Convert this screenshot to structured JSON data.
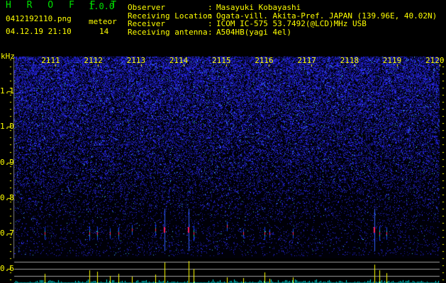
{
  "header": {
    "app_title": "H R O F F T",
    "version": "1.0.0",
    "filename": "0412192110.png",
    "datetime": "04.12.19 21:10",
    "meteor_label": "meteor",
    "meteor_count": "14",
    "info": [
      {
        "label": "Observer",
        "value": "Masayuki Kobayashi"
      },
      {
        "label": "Receiving Location",
        "value": "Ogata-vill. Akita-Pref. JAPAN (139.96E, 40.02N)"
      },
      {
        "label": "Receiver",
        "value": "ICOM IC-575 53.7492(@LCD)MHz USB"
      },
      {
        "label": "Receiving antenna",
        "value": "A504HB(yagi 4el)"
      }
    ]
  },
  "chart_data": {
    "type": "heatmap",
    "ylabel": "kHz",
    "x_ticks": [
      "2111",
      "2112",
      "2113",
      "2114",
      "2115",
      "2116",
      "2117",
      "2118",
      "2119",
      "2120"
    ],
    "y_ticks": [
      "1.1",
      "1.0",
      "0.9",
      "0.8",
      "0.7",
      "0.6"
    ],
    "ylim": [
      0.56,
      1.2
    ],
    "xlim_minutes_after_2110": [
      0,
      10
    ],
    "colors": {
      "noise": "#2020ff",
      "meteor_peak": "#ff2060",
      "bars": "#ffff00",
      "baseline": "#00e8e8",
      "text": "#ffff00"
    },
    "meteors": [
      {
        "t": 0.75,
        "f": 0.7,
        "strength": 13
      },
      {
        "t": 1.8,
        "f": 0.7,
        "strength": 18
      },
      {
        "t": 1.97,
        "f": 0.7,
        "strength": 16
      },
      {
        "t": 2.28,
        "f": 0.7,
        "strength": 10
      },
      {
        "t": 2.47,
        "f": 0.7,
        "strength": 13
      },
      {
        "t": 2.79,
        "f": 0.71,
        "strength": 9
      },
      {
        "t": 3.34,
        "f": 0.71,
        "strength": 12
      },
      {
        "t": 3.55,
        "f": 0.71,
        "strength": 29
      },
      {
        "t": 4.12,
        "f": 0.71,
        "strength": 31
      },
      {
        "t": 4.23,
        "f": 0.7,
        "strength": 20
      },
      {
        "t": 5.02,
        "f": 0.72,
        "strength": 8
      },
      {
        "t": 5.4,
        "f": 0.7,
        "strength": 7
      },
      {
        "t": 5.9,
        "f": 0.7,
        "strength": 15
      },
      {
        "t": 6.02,
        "f": 0.7,
        "strength": 6
      },
      {
        "t": 6.56,
        "f": 0.7,
        "strength": 8
      },
      {
        "t": 8.47,
        "f": 0.71,
        "strength": 26
      },
      {
        "t": 8.58,
        "f": 0.7,
        "strength": 18
      },
      {
        "t": 8.75,
        "f": 0.7,
        "strength": 14
      }
    ]
  }
}
